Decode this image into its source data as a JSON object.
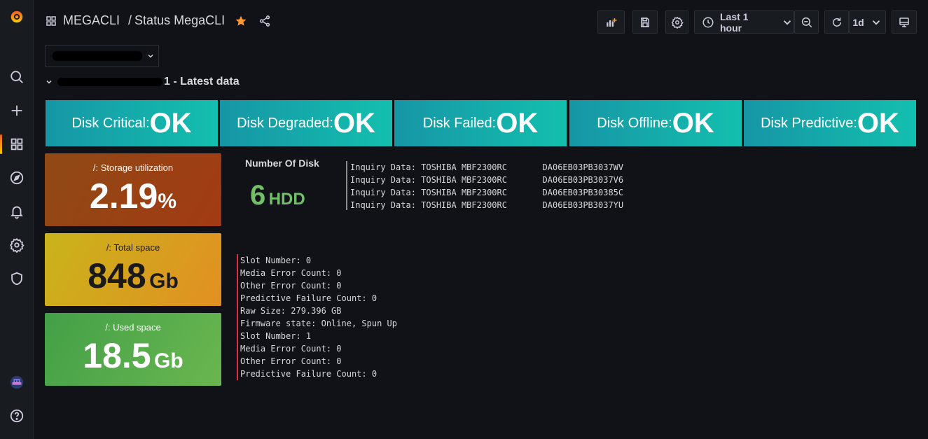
{
  "header": {
    "folder": "MEGACLI",
    "separator": "/",
    "title": "Status MegaCLI",
    "time_range": "Last 1 hour",
    "refresh": "1d"
  },
  "variable": {
    "value": "…"
  },
  "row": {
    "title_visible": "1 - Latest data"
  },
  "tiles": [
    {
      "label": "Disk Critical:",
      "value": "OK"
    },
    {
      "label": "Disk Degraded:",
      "value": "OK"
    },
    {
      "label": "Disk Failed:",
      "value": "OK"
    },
    {
      "label": "Disk Offline:",
      "value": "OK"
    },
    {
      "label": "Disk Predictive:",
      "value": "OK"
    }
  ],
  "stats": [
    {
      "title": "/: Storage utilization",
      "value": "2.19",
      "unit": "%",
      "color_from": "#8f4a14",
      "color_to": "#a33a14"
    },
    {
      "title": "/: Total space",
      "value": "848",
      "unit": "Gb",
      "color_from": "#c9b41a",
      "color_to": "#e28f22"
    },
    {
      "title": "/: Used space",
      "value": "18.5",
      "unit": "Gb",
      "color_from": "#43a047",
      "color_to": "#6ab650"
    }
  ],
  "disk_count": {
    "title": "Number Of Disk",
    "value": "6",
    "unit": "HDD",
    "color": "#73bf69"
  },
  "inquiry_lines": [
    "Inquiry Data: TOSHIBA MBF2300RC       DA06EB03PB3037WV",
    "Inquiry Data: TOSHIBA MBF2300RC       DA06EB03PB3037V6",
    "Inquiry Data: TOSHIBA MBF2300RC       DA06EB03PB30385C",
    "Inquiry Data: TOSHIBA MBF2300RC       DA06EB03PB3037YU"
  ],
  "slot_lines": [
    "Slot Number: 0",
    "Media Error Count: 0",
    "Other Error Count: 0",
    "Predictive Failure Count: 0",
    "Raw Size: 279.396 GB",
    "Firmware state: Online, Spun Up",
    "Slot Number: 1",
    "Media Error Count: 0",
    "Other Error Count: 0",
    "Predictive Failure Count: 0"
  ],
  "colors": {
    "accent": "#f05a28",
    "star": "#ff9830",
    "tile": "#13bfae"
  },
  "icons": [
    "grafana-logo-icon",
    "search-icon",
    "plus-icon",
    "dashboards-icon",
    "explore-icon",
    "alert-bell-icon",
    "gear-icon",
    "shield-icon",
    "avatar-icon",
    "help-icon"
  ]
}
